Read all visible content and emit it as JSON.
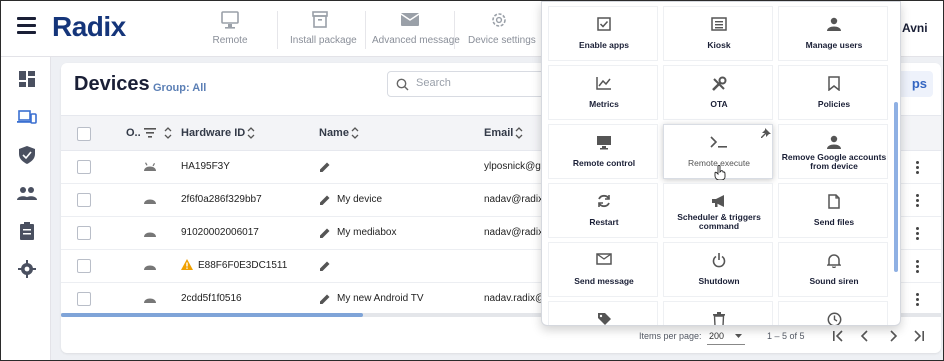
{
  "header": {
    "logo": "Radix",
    "user": "Avni",
    "tools": [
      {
        "label": "Remote",
        "icon": "monitor-icon"
      },
      {
        "label": "Install package",
        "icon": "package-icon"
      },
      {
        "label": "Advanced message",
        "icon": "envelope-icon"
      },
      {
        "label": "Device settings",
        "icon": "gear-icon"
      }
    ]
  },
  "sidebar": {
    "items": [
      {
        "name": "dashboard",
        "icon": "dashboard-icon"
      },
      {
        "name": "devices",
        "icon": "devices-icon"
      },
      {
        "name": "security",
        "icon": "shield-icon"
      },
      {
        "name": "users",
        "icon": "people-icon"
      },
      {
        "name": "reports",
        "icon": "clipboard-icon"
      },
      {
        "name": "settings",
        "icon": "gear-icon"
      }
    ]
  },
  "page": {
    "title": "Devices",
    "group": "Group: All",
    "search_placeholder": "Search",
    "groups_button_partial": "ps"
  },
  "table": {
    "columns": [
      "O..",
      "Hardware ID",
      "Name",
      "Email"
    ],
    "rows": [
      {
        "hardware_id": "HA195F3Y",
        "name": "",
        "email": "ylposnick@gr",
        "warning": false
      },
      {
        "hardware_id": "2f6f0a286f329bb7",
        "name": "My device",
        "email": "nadav@radix",
        "warning": false
      },
      {
        "hardware_id": "91020002006017",
        "name": "My mediabox",
        "email": "nadav@radix",
        "warning": false
      },
      {
        "hardware_id": "E88F6F0E3DC1511",
        "name": "",
        "email": "",
        "warning": true
      },
      {
        "hardware_id": "2cdd5f1f0516",
        "name": "My new Android TV",
        "email": "nadav.radix@",
        "warning": false
      }
    ]
  },
  "pagination": {
    "items_per_page_label": "Items per page:",
    "items_per_page_value": "200",
    "range": "1 – 5 of 5"
  },
  "menu": {
    "tiles": [
      {
        "label": "Enable apps",
        "icon": "checkbox-icon"
      },
      {
        "label": "Kiosk",
        "icon": "kiosk-icon"
      },
      {
        "label": "Manage users",
        "icon": "person-icon"
      },
      {
        "label": "Metrics",
        "icon": "chart-icon"
      },
      {
        "label": "OTA",
        "icon": "tools-icon"
      },
      {
        "label": "Policies",
        "icon": "bookmark-icon"
      },
      {
        "label": "Remote control",
        "icon": "monitor-icon"
      },
      {
        "label": "Remote execute",
        "icon": "terminal-icon"
      },
      {
        "label": "Remove Google accounts from device",
        "icon": "person-icon"
      },
      {
        "label": "Restart",
        "icon": "restart-icon"
      },
      {
        "label": "Scheduler & triggers command",
        "icon": "megaphone-icon"
      },
      {
        "label": "Send files",
        "icon": "file-icon"
      },
      {
        "label": "Send message",
        "icon": "envelope-icon"
      },
      {
        "label": "Shutdown",
        "icon": "power-icon"
      },
      {
        "label": "Sound siren",
        "icon": "bell-icon"
      },
      {
        "label": "",
        "icon": "tag-icon"
      },
      {
        "label": "",
        "icon": "trash-icon"
      },
      {
        "label": "",
        "icon": "clock-icon"
      }
    ],
    "active_tile": "Remote execute"
  }
}
